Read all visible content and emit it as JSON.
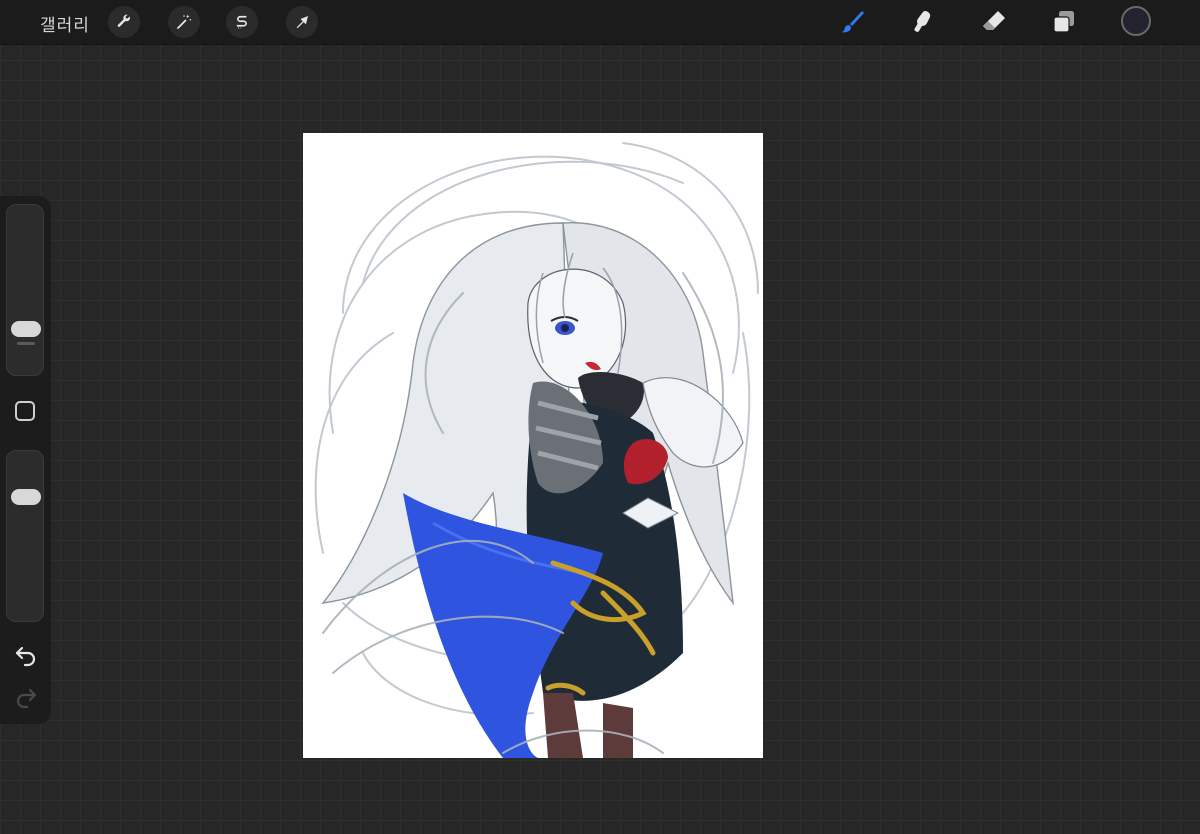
{
  "topbar": {
    "gallery_label": "갤러리",
    "left_tools": [
      {
        "name": "actions",
        "icon": "wrench-icon"
      },
      {
        "name": "adjustments",
        "icon": "magic-wand-icon"
      },
      {
        "name": "selection",
        "icon": "selection-s-icon"
      },
      {
        "name": "transform",
        "icon": "transform-arrow-icon"
      }
    ],
    "right_tools": [
      {
        "name": "brush",
        "icon": "brush-icon",
        "active": true
      },
      {
        "name": "smudge",
        "icon": "smudge-finger-icon",
        "active": false
      },
      {
        "name": "eraser",
        "icon": "eraser-icon",
        "active": false
      },
      {
        "name": "layers",
        "icon": "layers-icon",
        "active": false
      }
    ],
    "current_color": "#22232f",
    "active_color": "#2f7bf5"
  },
  "sidebar": {
    "brush_size_level": 0.3,
    "opacity_level": 0.85,
    "undo_icon": "undo-arrow-icon",
    "redo_icon": "redo-arrow-icon",
    "modify_icon": "square-modify-icon"
  },
  "canvas": {
    "background": "#ffffff"
  }
}
